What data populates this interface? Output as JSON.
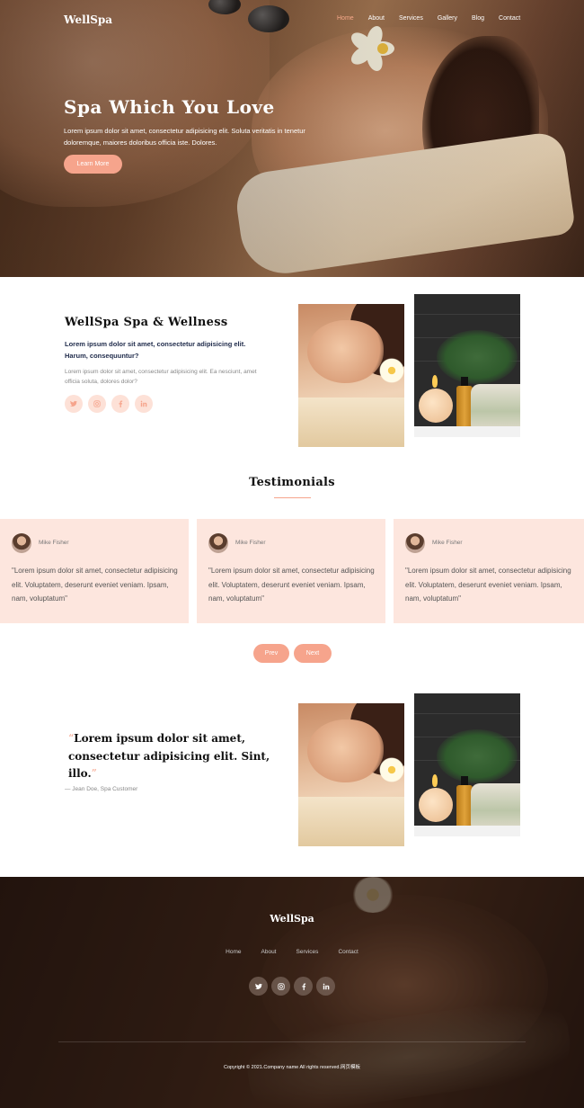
{
  "nav": {
    "logo": "WellSpa",
    "links": [
      "Home",
      "About",
      "Services",
      "Gallery",
      "Blog",
      "Contact"
    ],
    "active": "Home"
  },
  "hero": {
    "title": "Spa Which You Love",
    "text": "Lorem ipsum dolor sit amet, consectetur adipisicing elit. Soluta veritatis in tenetur doloremque, maiores doloribus officia iste. Dolores.",
    "button": "Learn More"
  },
  "about": {
    "title": "WellSpa Spa & Wellness",
    "lead": "Lorem ipsum dolor sit amet, consectetur adipisicing elit. Harum, consequuntur?",
    "text": "Lorem ipsum dolor sit amet, consectetur adipisicing elit. Ea nesciunt, amet officia soluta, dolores dolor?",
    "social": [
      "twitter-icon",
      "instagram-icon",
      "facebook-icon",
      "linkedin-icon"
    ]
  },
  "testimonials": {
    "heading": "Testimonials",
    "items": [
      {
        "name": "Mike Fisher",
        "quote": "\"Lorem ipsum dolor sit amet, consectetur adipisicing elit. Voluptatem, deserunt eveniet veniam. Ipsam, nam, voluptatum\""
      },
      {
        "name": "Mike Fisher",
        "quote": "\"Lorem ipsum dolor sit amet, consectetur adipisicing elit. Voluptatem, deserunt eveniet veniam. Ipsam, nam, voluptatum\""
      },
      {
        "name": "Mike Fisher",
        "quote": "\"Lorem ipsum dolor sit amet, consectetur adipisicing elit. Voluptatem, deserunt eveniet veniam. Ipsam, nam, voluptatum\""
      }
    ],
    "prev": "Prev",
    "next": "Next"
  },
  "quote": {
    "open": "“",
    "text": "Lorem ipsum dolor sit amet, consectetur adipisicing elit. Sint, illo.",
    "close": "”",
    "author": "— Jean Doe, Spa Customer"
  },
  "footer": {
    "logo": "WellSpa",
    "links": [
      "Home",
      "About",
      "Services",
      "Contact"
    ],
    "copyright": "Copyright © 2021.Company name All rights reserved.网页模板"
  },
  "colors": {
    "accent": "#f6a48c",
    "card_bg": "#fde6de",
    "heading": "#111111"
  }
}
